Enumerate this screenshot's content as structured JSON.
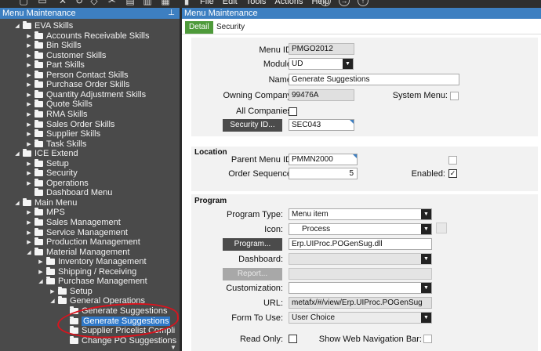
{
  "menubar": {
    "items": [
      "File",
      "Edit",
      "Tools",
      "Actions",
      "Help"
    ]
  },
  "left_panel": {
    "title": "Menu Maintenance",
    "tree": [
      {
        "label": "EVA Skills",
        "level": 0,
        "expanded": true
      },
      {
        "label": "Accounts Receivable Skills",
        "level": 1
      },
      {
        "label": "Bin Skills",
        "level": 1
      },
      {
        "label": "Customer Skills",
        "level": 1
      },
      {
        "label": "Part Skills",
        "level": 1
      },
      {
        "label": "Person Contact Skills",
        "level": 1
      },
      {
        "label": "Purchase Order Skills",
        "level": 1
      },
      {
        "label": "Quantity Adjustment Skills",
        "level": 1
      },
      {
        "label": "Quote Skills",
        "level": 1
      },
      {
        "label": "RMA Skills",
        "level": 1
      },
      {
        "label": "Sales Order Skills",
        "level": 1
      },
      {
        "label": "Supplier Skills",
        "level": 1
      },
      {
        "label": "Task Skills",
        "level": 1
      },
      {
        "label": "ICE Extend",
        "level": 0,
        "expanded": true
      },
      {
        "label": "Setup",
        "level": 1
      },
      {
        "label": "Security",
        "level": 1
      },
      {
        "label": "Operations",
        "level": 1
      },
      {
        "label": "Dashboard Menu",
        "level": 1,
        "leaf": true
      },
      {
        "label": "Main Menu",
        "level": 0,
        "expanded": true
      },
      {
        "label": "MPS",
        "level": 1
      },
      {
        "label": "Sales Management",
        "level": 1
      },
      {
        "label": "Service Management",
        "level": 1
      },
      {
        "label": "Production Management",
        "level": 1
      },
      {
        "label": "Material Management",
        "level": 1,
        "expanded": true
      },
      {
        "label": "Inventory Management",
        "level": 2
      },
      {
        "label": "Shipping / Receiving",
        "level": 2
      },
      {
        "label": "Purchase Management",
        "level": 2,
        "expanded": true
      },
      {
        "label": "Setup",
        "level": 3
      },
      {
        "label": "General Operations",
        "level": 3,
        "expanded": true
      },
      {
        "label": "Generate Suggestions",
        "level": 4,
        "leaf": true
      },
      {
        "label": "Generate Suggestions",
        "level": 4,
        "leaf": true,
        "selected": true
      },
      {
        "label": "Supplier Pricelist Compli",
        "level": 4,
        "leaf": true
      },
      {
        "label": "Change PO Suggestions",
        "level": 4,
        "leaf": true
      }
    ]
  },
  "right_panel": {
    "title": "Menu Maintenance",
    "tabs": [
      {
        "label": "Detail",
        "active": true
      },
      {
        "label": "Security",
        "active": false
      }
    ],
    "detail": {
      "menu_id_label": "Menu ID:",
      "menu_id": "PMGO2012",
      "module_label": "Module:",
      "module": "UD",
      "name_label": "Name:",
      "name": "Generate Suggestions",
      "owning_company_label": "Owning Company:",
      "owning_company": "99476A",
      "system_menu_label": "System Menu:",
      "all_companies_label": "All Companies:",
      "security_id_button": "Security ID...",
      "security_id": "SEC043"
    },
    "location": {
      "title": "Location",
      "parent_menu_id_label": "Parent Menu ID:",
      "parent_menu_id": "PMMN2000",
      "order_sequence_label": "Order Sequence:",
      "order_sequence": "5",
      "enabled_label": "Enabled:",
      "enabled_check": "✓"
    },
    "program": {
      "title": "Program",
      "program_type_label": "Program Type:",
      "program_type": "Menu item",
      "icon_label": "Icon:",
      "icon_value": "Process",
      "program_button": "Program...",
      "program_value": "Erp.UIProc.POGenSug.dll",
      "dashboard_label": "Dashboard:",
      "report_button": "Report...",
      "customization_label": "Customization:",
      "url_label": "URL:",
      "url_value": "metafx/#/view/Erp.UIProc.POGenSug",
      "form_to_use_label": "Form To Use:",
      "form_to_use": "User Choice",
      "read_only_label": "Read Only:",
      "show_web_nav_label": "Show Web Navigation Bar:"
    }
  },
  "icons": [
    "new-icon",
    "copy-icon",
    "delete-icon",
    "refresh-icon",
    "cut-icon",
    "paste-icon",
    "print-icon",
    "back-icon",
    "forward-icon",
    "pin-icon",
    "folder-icon",
    "dropdown-icon"
  ]
}
